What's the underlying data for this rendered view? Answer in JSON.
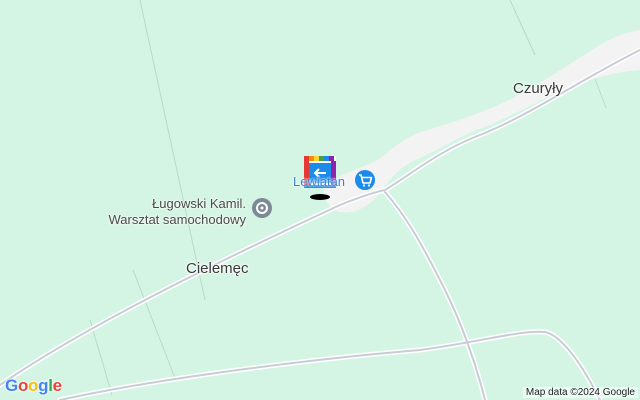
{
  "map": {
    "places": {
      "czuryly": "Czuryły",
      "cielemec": "Cielemęc"
    },
    "pois": {
      "workshop_line1": "Ługowski Kamil.",
      "workshop_line2": "Warsztat samochodowy",
      "store_label": "Lewiatan"
    },
    "icons": {
      "workshop": "wrench-pin-icon",
      "store": "shopping-cart-icon",
      "marker": "flag-marker-icon"
    },
    "attribution": "Map data ©2024 Google",
    "logo": "Google",
    "colors": {
      "land": "#d4f5e4",
      "road": "#c9ccd6",
      "built_up": "#f2f2f2",
      "poi_blue": "#1a8be8",
      "poi_gray": "#7d8a96"
    }
  }
}
